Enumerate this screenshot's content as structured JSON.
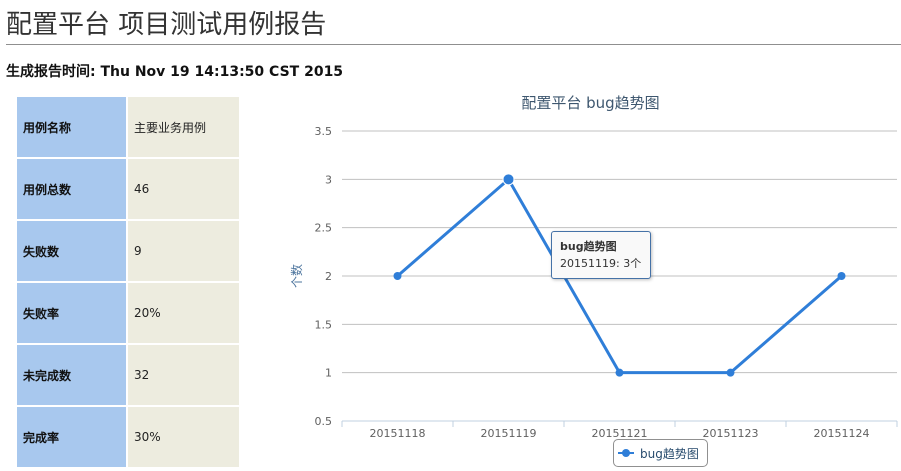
{
  "header": {
    "title": "配置平台 项目测试用例报告",
    "report_time": "生成报告时间: Thu Nov 19 14:13:50 CST 2015"
  },
  "summary": [
    {
      "label": "用例名称",
      "value": "主要业务用例"
    },
    {
      "label": "用例总数",
      "value": "46"
    },
    {
      "label": "失败数",
      "value": "9"
    },
    {
      "label": "失败率",
      "value": "20%"
    },
    {
      "label": "未完成数",
      "value": "32"
    },
    {
      "label": "完成率",
      "value": "30%"
    }
  ],
  "colors": {
    "series": "#2f7ed8",
    "table_key_bg": "#a8c8ee",
    "table_value_bg": "#edecdf"
  },
  "chart_data": {
    "type": "line",
    "title": "配置平台 bug趋势图",
    "xlabel": "",
    "ylabel": "个数",
    "categories": [
      "20151118",
      "20151119",
      "20151121",
      "20151123",
      "20151124"
    ],
    "series": [
      {
        "name": "bug趋势图",
        "values": [
          2,
          3,
          1,
          1,
          2
        ]
      }
    ],
    "ylim": [
      0.5,
      3.5
    ],
    "yticks": [
      "0.5",
      "1",
      "1.5",
      "2",
      "2.5",
      "3",
      "3.5"
    ],
    "grid": true,
    "legend": "bottom-center",
    "tooltip": {
      "title": "bug趋势图",
      "text": "20151119: 3个"
    }
  }
}
